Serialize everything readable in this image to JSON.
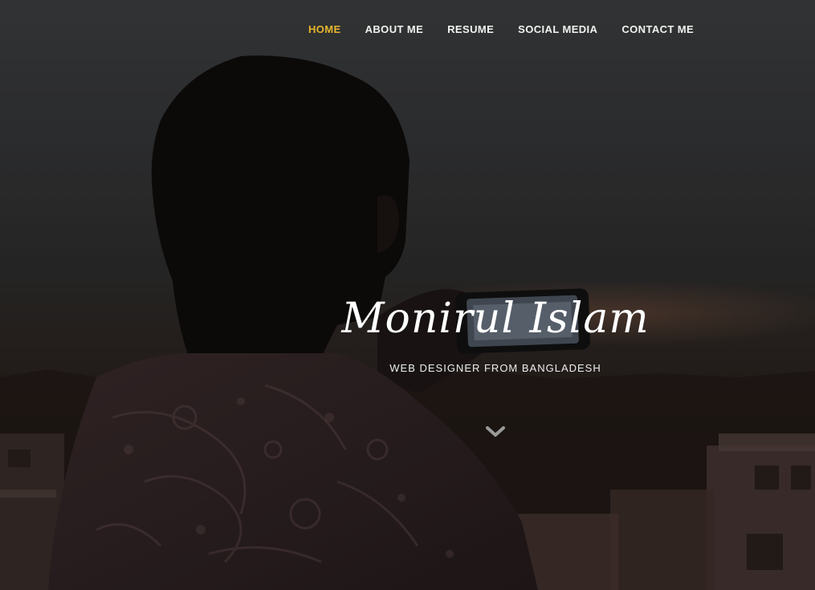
{
  "nav": {
    "items": [
      {
        "label": "HOME",
        "active": true
      },
      {
        "label": "ABOUT ME",
        "active": false
      },
      {
        "label": "RESUME",
        "active": false
      },
      {
        "label": "SOCIAL MEDIA",
        "active": false
      },
      {
        "label": "CONTACT ME",
        "active": false
      }
    ],
    "active_color": "#e5b52e",
    "text_color": "#f2f2f2"
  },
  "hero": {
    "name": "Monirul Islam",
    "tagline": "WEB DESIGNER FROM BANGLADESH",
    "scroll_icon": "chevron-down-icon"
  }
}
